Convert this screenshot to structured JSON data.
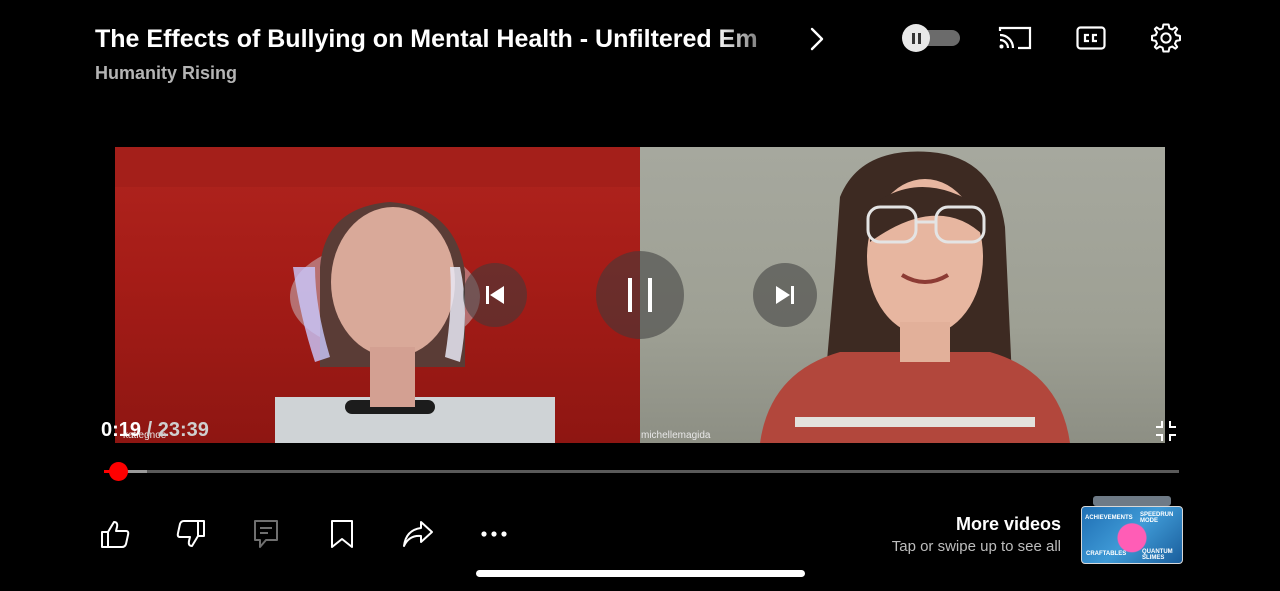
{
  "header": {
    "title": "The Effects of Bullying on Mental Health - Unfiltered Em",
    "channel": "Humanity Rising"
  },
  "video": {
    "left_label": "katiegnoe",
    "right_label": "michellemagida"
  },
  "player": {
    "current_time": "0:19",
    "separator": " / ",
    "duration": "23:39",
    "progress_fraction": 0.0134,
    "buffered_fraction": 0.04
  },
  "more_videos": {
    "title": "More videos",
    "subtitle": "Tap or swipe up to see all",
    "thumbnail_text": [
      "ACHIEVEMENTS",
      "SPEEDRUN MODE",
      "CRAFTABLES",
      "QUANTUM SLIMES"
    ]
  },
  "icons": {
    "autoplay": "autoplay-toggle-icon",
    "cast": "cast-icon",
    "captions": "cc-icon",
    "settings": "gear-icon",
    "like": "thumbs-up-icon",
    "dislike": "thumbs-down-icon",
    "comments": "comment-icon",
    "save": "bookmark-icon",
    "share": "share-icon",
    "more": "more-icon",
    "exit_fullscreen": "exit-fullscreen-icon"
  },
  "colors": {
    "progress": "#ff0000",
    "background": "#000000"
  }
}
